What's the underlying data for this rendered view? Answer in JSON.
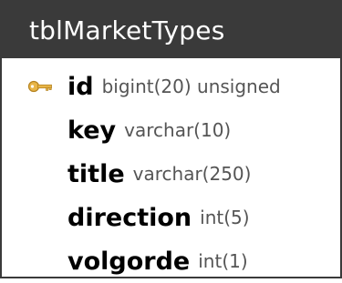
{
  "table": {
    "name": "tblMarketTypes",
    "header_bg": "#3a3a3a",
    "header_text_color": "#ffffff",
    "border_color": "#3a3a3a",
    "fields": [
      {
        "name": "id",
        "type": "bigint(20) unsigned",
        "primary_key": true,
        "icon": "key-icon"
      },
      {
        "name": "key",
        "type": "varchar(10)",
        "primary_key": false
      },
      {
        "name": "title",
        "type": "varchar(250)",
        "primary_key": false
      },
      {
        "name": "direction",
        "type": "int(5)",
        "primary_key": false
      },
      {
        "name": "volgorde",
        "type": "int(1)",
        "primary_key": false
      }
    ]
  }
}
